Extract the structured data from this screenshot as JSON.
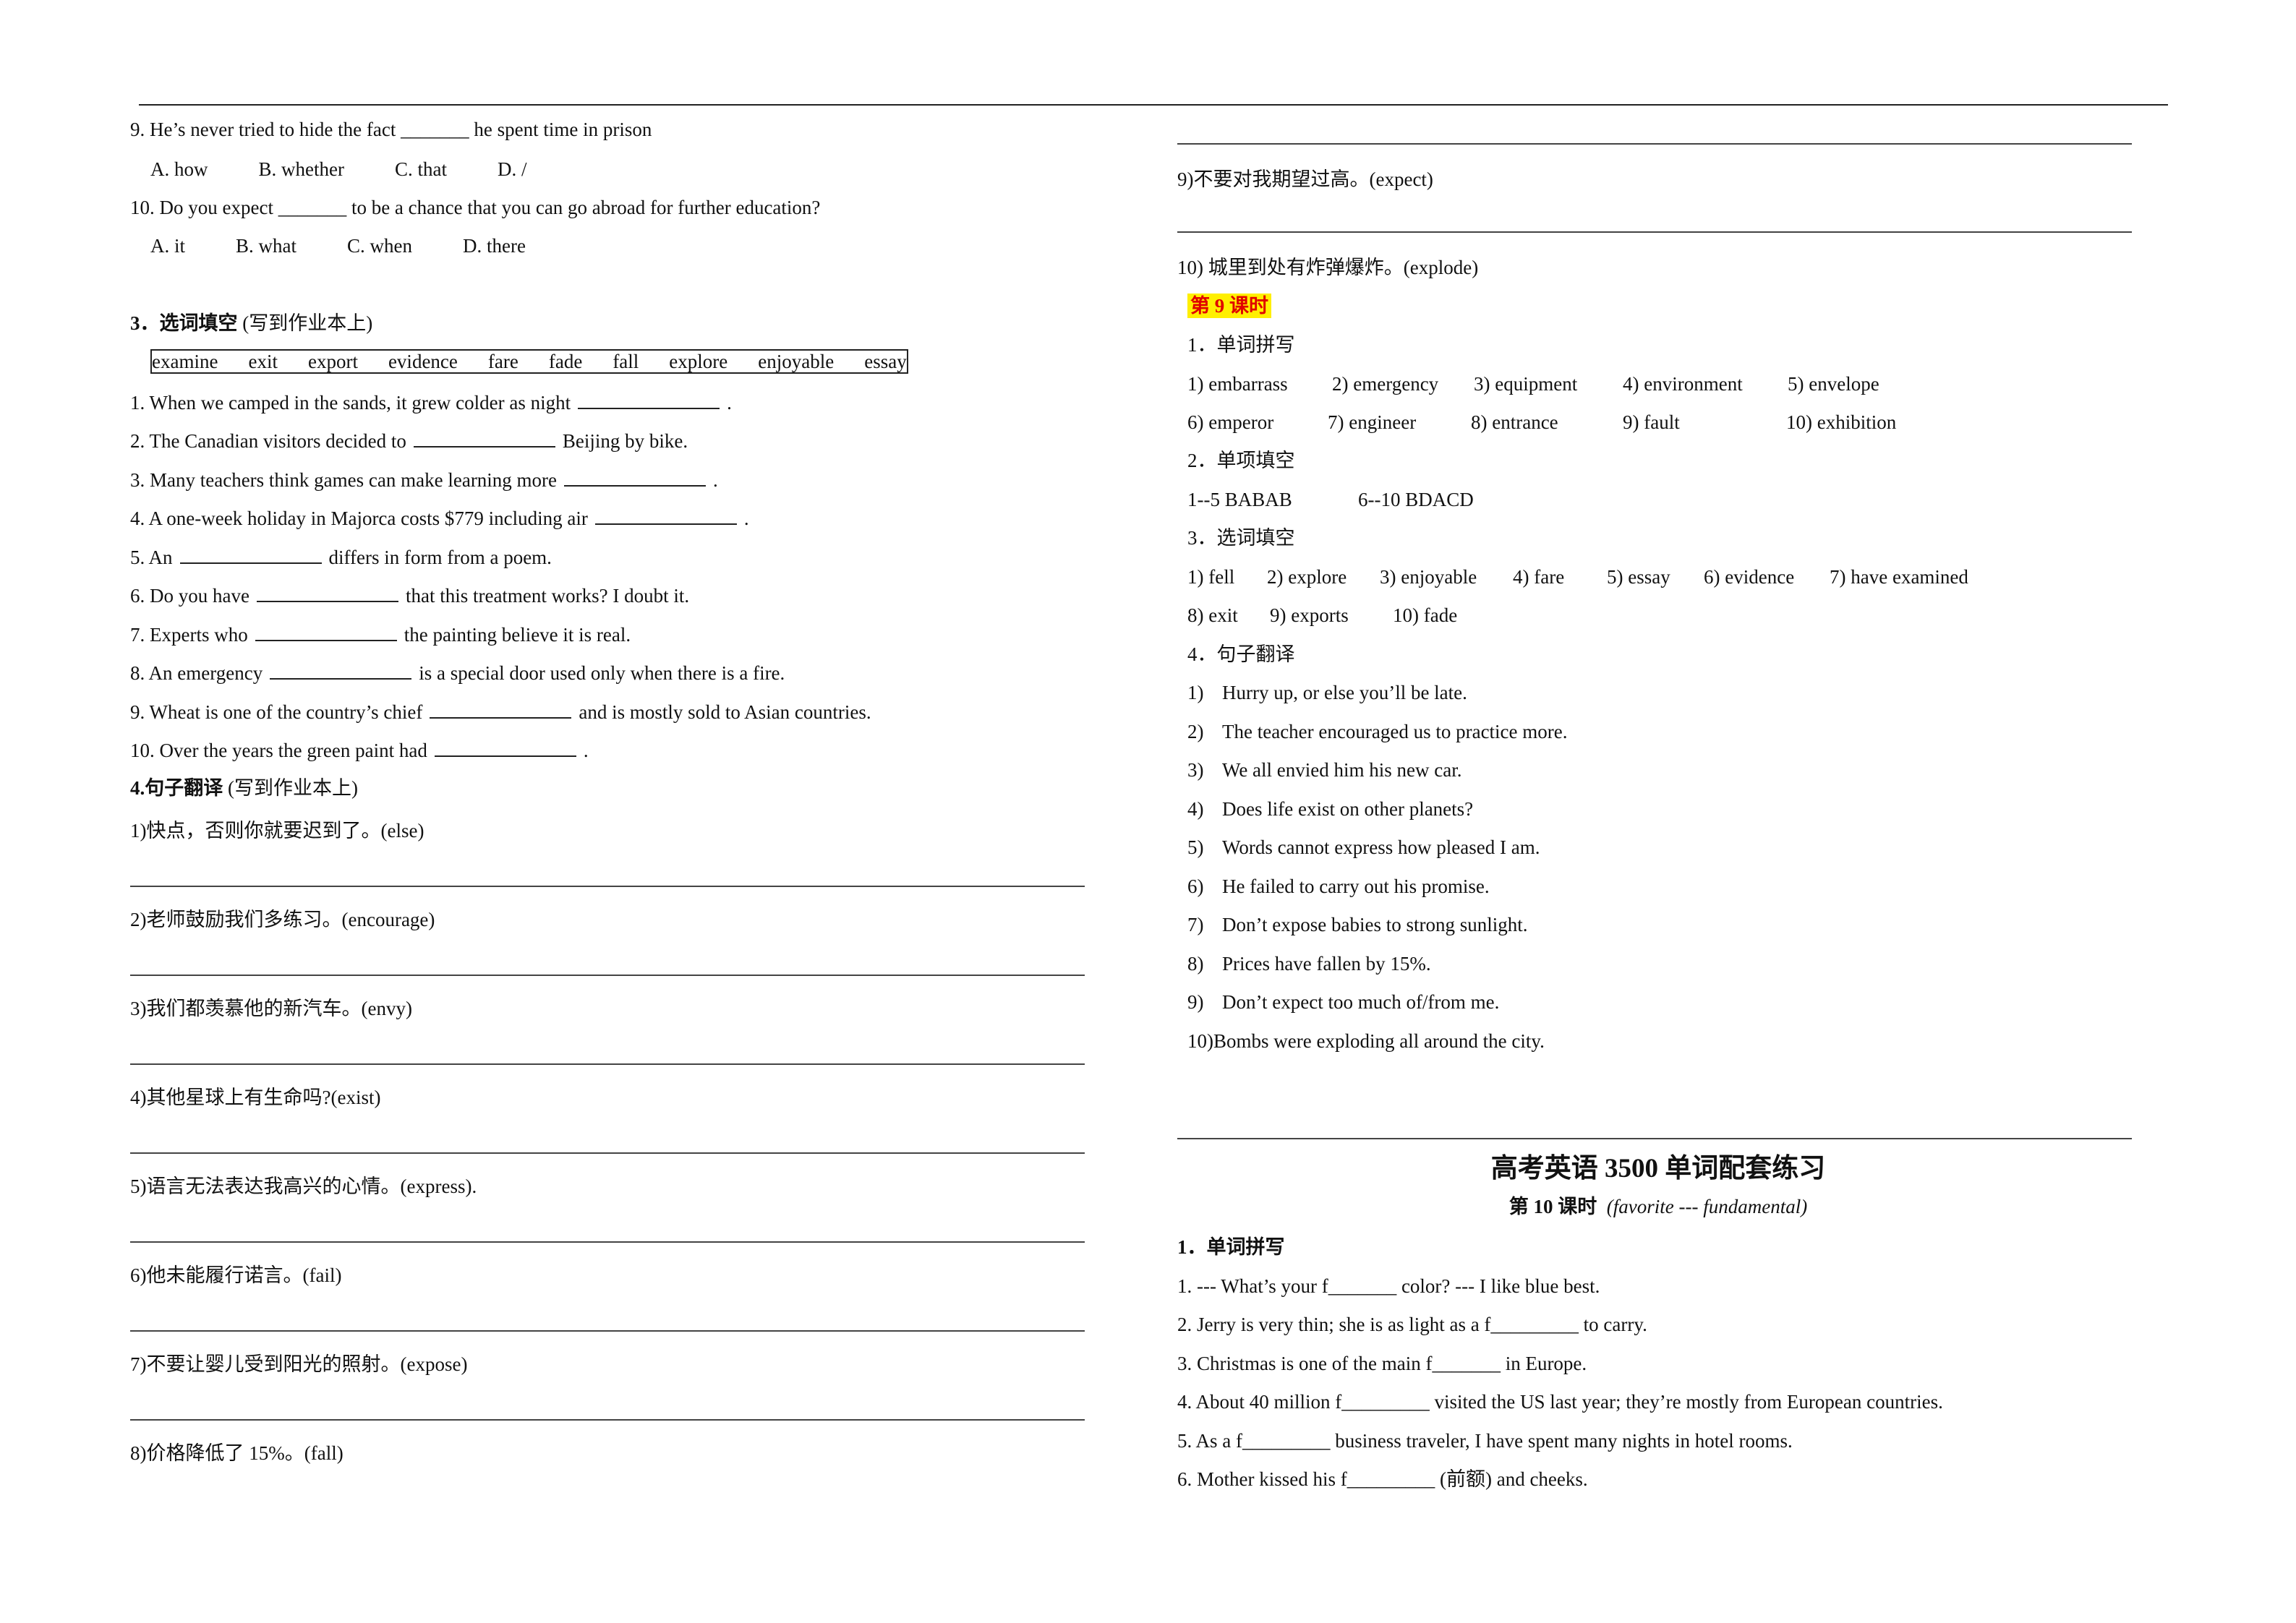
{
  "left": {
    "mc_items": [
      {
        "question": "9. He’s never tried to hide the fact _______ he spent time in prison",
        "options": [
          "A. how",
          "B. whether",
          "C. that",
          "D. /"
        ]
      },
      {
        "question": "10. Do you expect _______ to be a chance that you can go abroad for further education?",
        "options": [
          "A. it",
          "B. what",
          "C. when",
          "D. there"
        ]
      }
    ],
    "section3_heading_num": "3．选词填空",
    "section3_heading_note": "(写到作业本上)",
    "word_bank": [
      "examine",
      "exit",
      "export",
      "evidence",
      "fare",
      "fade",
      "fall",
      "explore",
      "enjoyable",
      "essay"
    ],
    "fill_items": [
      {
        "before": "1. When we camped in the sands, it grew colder as night",
        "after": "."
      },
      {
        "before": "2. The Canadian visitors decided to",
        "after": "Beijing by bike."
      },
      {
        "before": "3. Many teachers think games can make learning more",
        "after": "."
      },
      {
        "before": "4. A one-week holiday in Majorca costs $779 including air",
        "after": "."
      },
      {
        "before": "5. An",
        "after": "differs in form from a poem."
      },
      {
        "before": "6. Do you have",
        "after": "that this treatment works? I doubt it."
      },
      {
        "before": "7. Experts who",
        "after": "the painting believe it is real."
      },
      {
        "before": "8. An emergency",
        "after": "is a special door used only when there is a fire."
      },
      {
        "before": "9. Wheat is one of the country’s chief",
        "after": "and is mostly sold to Asian countries."
      },
      {
        "before": "10. Over the years the green paint had",
        "after": "."
      }
    ],
    "section4_heading_num": "4.句子翻译",
    "section4_heading_note": "(写到作业本上)",
    "translations": [
      "1)快点，否则你就要迟到了。(else)",
      "2)老师鼓励我们多练习。(encourage)",
      "3)我们都羡慕他的新汽车。(envy)",
      "4)其他星球上有生命吗?(exist)",
      "5)语言无法表达我高兴的心情。(express).",
      "6)他未能履行诺言。(fail)",
      "7)不要让婴儿受到阳光的照射。(expose)",
      "8)价格降低了 15%。(fall)"
    ]
  },
  "right": {
    "translations_cont": [
      "9)不要对我期望过高。(expect)",
      "10)  城里到处有炸弹爆炸。(explode)"
    ],
    "lesson9_label": "第 9 课时",
    "sec1_label": "1．单词拼写",
    "spelling_row1": [
      "1) embarrass",
      "2) emergency",
      "3) equipment",
      "4) environment",
      "5) envelope"
    ],
    "spelling_row2": [
      "6) emperor",
      "7) engineer",
      "8) entrance",
      "9) fault",
      "10) exhibition"
    ],
    "sec2_label": "2．单项填空",
    "mc_answers": [
      "1--5 BABAB",
      "6--10 BDACD"
    ],
    "sec3_label": "3．选词填空",
    "fill_row1": [
      "1) fell",
      "2) explore",
      "3) enjoyable",
      "4) fare",
      "5) essay",
      "6) evidence",
      "7) have examined"
    ],
    "fill_row2": [
      "8) exit",
      "9) exports",
      "10) fade"
    ],
    "sec4_label": "4．句子翻译",
    "sentence_answers": [
      {
        "n": "1)",
        "t": "Hurry up, or else you’ll be late."
      },
      {
        "n": "2)",
        "t": "The teacher encouraged us to practice more."
      },
      {
        "n": "3)",
        "t": "We all envied him his new car."
      },
      {
        "n": "4)",
        "t": "Does life exist on other planets?"
      },
      {
        "n": "5)",
        "t": "Words cannot express how pleased I am."
      },
      {
        "n": "6)",
        "t": "He failed to carry out his promise."
      },
      {
        "n": "7)",
        "t": "Don’t expose babies to strong sunlight."
      },
      {
        "n": "8)",
        "t": "Prices have fallen by 15%."
      },
      {
        "n": "9)",
        "t": "Don’t expect too much of/from me."
      }
    ],
    "sentence_answer_10": "10)Bombs were exploding all around the city.",
    "book_title": "高考英语 3500 单词配套练习",
    "lesson10_label": "第 10 课时",
    "lesson10_range": "(favorite --- fundamental)",
    "l10_sec1_label": "1．单词拼写",
    "l10_items": [
      "1. --- What’s your f_______ color?      --- I like blue best.",
      "2. Jerry is very thin; she is as light as a f_________ to carry.",
      "3. Christmas is one of the main f_______ in Europe.",
      "4. About 40 million f_________ visited the US last year; they’re mostly from European countries.",
      "5. As a f_________ business traveler, I have spent many nights in hotel rooms.",
      "6. Mother kissed his f_________ (前额) and cheeks."
    ]
  },
  "colors": {
    "highlight_bg": "#ffef00",
    "highlight_text": "#e00000"
  }
}
